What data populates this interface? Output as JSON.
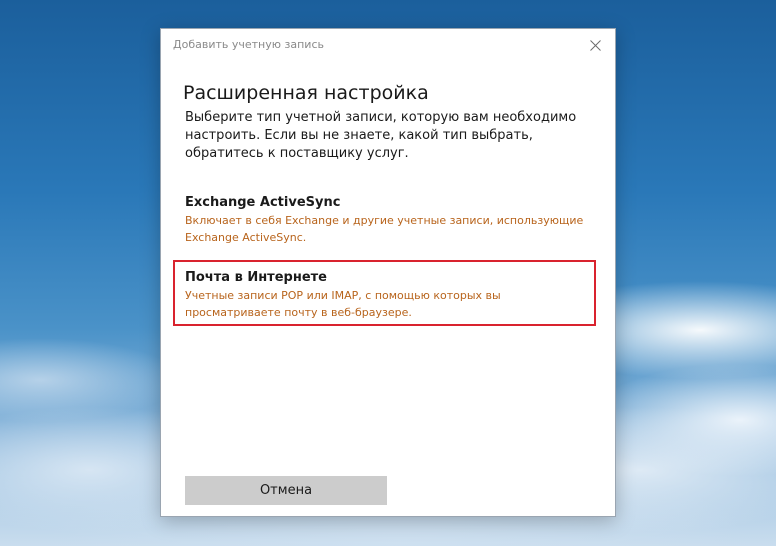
{
  "window": {
    "title": "Добавить учетную запись",
    "close_icon": "close-icon"
  },
  "main": {
    "heading": "Расширенная настройка",
    "description": "Выберите тип учетной записи, которую вам необходимо настроить. Если вы не знаете, какой тип выбрать, обратитесь к поставщику услуг."
  },
  "options": [
    {
      "title": "Exchange ActiveSync",
      "description": "Включает в себя Exchange и другие учетные записи, использующие Exchange ActiveSync."
    },
    {
      "title": "Почта в Интернете",
      "description": "Учетные записи POP или IMAP, с помощью которых вы просматриваете почту в веб-браузере.",
      "highlighted": true
    }
  ],
  "footer": {
    "cancel_label": "Отмена"
  },
  "colors": {
    "option_description": "#b8641c",
    "highlight_border": "#d9232e",
    "button_background": "#cccccc"
  }
}
